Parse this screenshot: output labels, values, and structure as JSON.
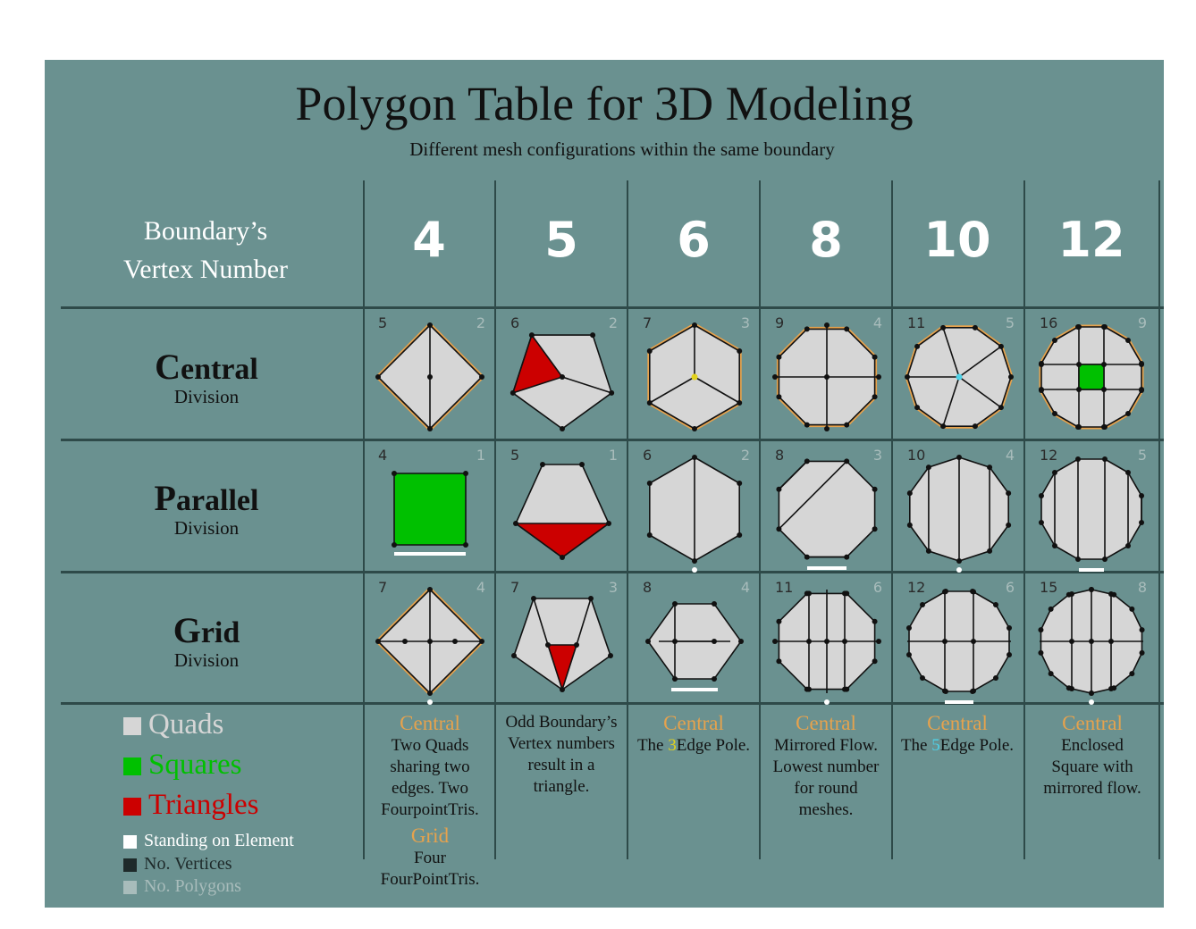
{
  "title": "Polygon Table for 3D Modeling",
  "subtitle": "Different mesh configurations within the same boundary",
  "header": {
    "label_line1": "Boundary’s",
    "label_line2": "Vertex Number",
    "columns": [
      "4",
      "5",
      "6",
      "8",
      "10",
      "12"
    ]
  },
  "rows": [
    {
      "first_letter": "C",
      "rest": "entral",
      "sub": "Division"
    },
    {
      "first_letter": "P",
      "rest": "arallel",
      "sub": "Division"
    },
    {
      "first_letter": "G",
      "rest": "rid",
      "sub": "Division"
    }
  ],
  "cells": [
    [
      {
        "v": "5",
        "p": "2"
      },
      {
        "v": "6",
        "p": "2"
      },
      {
        "v": "7",
        "p": "3"
      },
      {
        "v": "9",
        "p": "4"
      },
      {
        "v": "11",
        "p": "5"
      },
      {
        "v": "16",
        "p": "9"
      }
    ],
    [
      {
        "v": "4",
        "p": "1"
      },
      {
        "v": "5",
        "p": "1"
      },
      {
        "v": "6",
        "p": "2"
      },
      {
        "v": "8",
        "p": "3"
      },
      {
        "v": "10",
        "p": "4"
      },
      {
        "v": "12",
        "p": "5"
      }
    ],
    [
      {
        "v": "7",
        "p": "4"
      },
      {
        "v": "7",
        "p": "3"
      },
      {
        "v": "8",
        "p": "4"
      },
      {
        "v": "11",
        "p": "6"
      },
      {
        "v": "12",
        "p": "6"
      },
      {
        "v": "15",
        "p": "8"
      }
    ]
  ],
  "legend": [
    {
      "label": "Quads",
      "color": "#d6d6d6"
    },
    {
      "label": "Squares",
      "color": "#00c000"
    },
    {
      "label": "Triangles",
      "color": "#cc0000"
    },
    {
      "label": "Standing on Element",
      "color": "#ffffff"
    },
    {
      "label": "No. Vertices",
      "color": "#1e2a2a"
    },
    {
      "label": "No. Polygons",
      "color": "#a8bcbb"
    }
  ],
  "notes": {
    "c4_head1": "Central",
    "c4_text1": "Two Quads sharing two edges. Two FourpointTris.",
    "c4_head2": "Grid",
    "c4_text2": "Four FourPointTris.",
    "c5_text": "Odd Boundary’s Vertex numbers result in a triangle.",
    "c6_head": "Central",
    "c6_pre": "The ",
    "c6_hl": "3",
    "c6_post": "Edge Pole.",
    "c8_head": "Central",
    "c8_text": "Mirrored Flow. Lowest number for round meshes.",
    "c10_head": "Central",
    "c10_pre": "The ",
    "c10_hl": "5",
    "c10_post": "Edge Pole.",
    "c12_head": "Central",
    "c12_text": "Enclosed Square with mirrored flow."
  },
  "colors": {
    "panel": "#6a9190",
    "quad": "#d6d6d6",
    "square": "#00c000",
    "triangle": "#cc0000",
    "edge": "#111111",
    "boundary_highlight": "#e6a24d",
    "pole3": "#e2d21c",
    "pole5": "#4fd2e8"
  }
}
